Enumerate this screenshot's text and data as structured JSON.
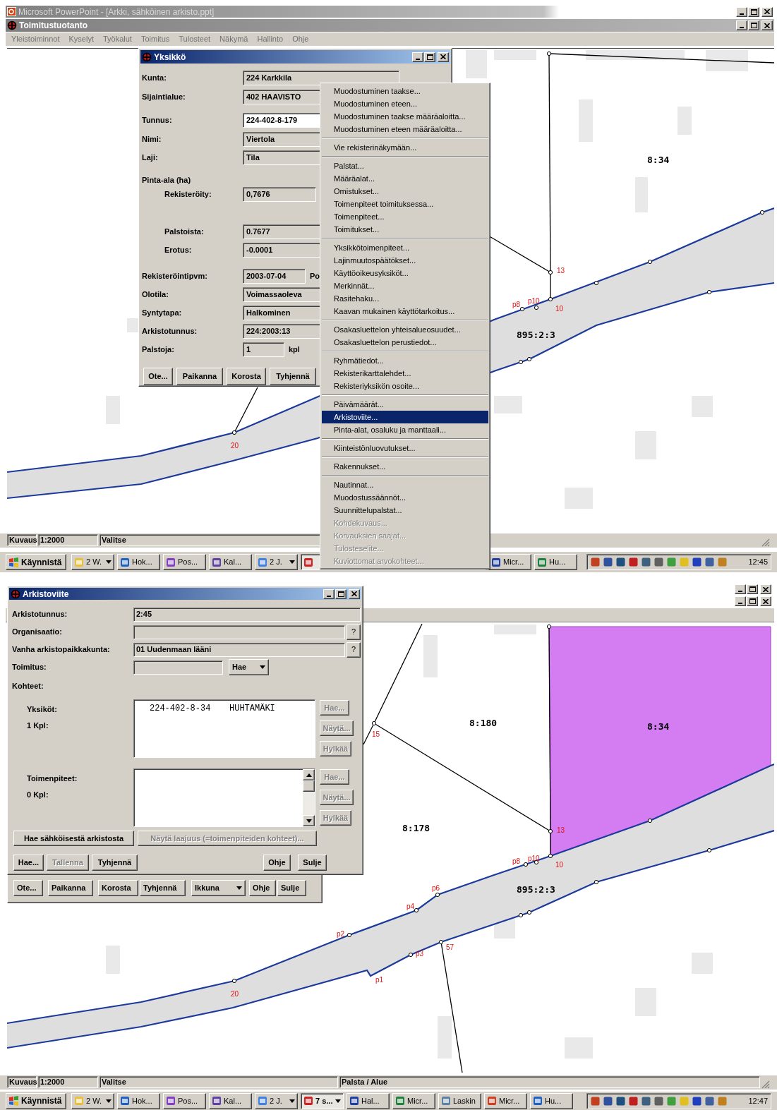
{
  "top": {
    "ppt_title": "Microsoft PowerPoint - [Arkki, sähköinen arkisto.ppt]",
    "app_title": "Toimitustuotanto",
    "menu": [
      "Yleistoiminnot",
      "Kyselyt",
      "Työkalut",
      "Toimitus",
      "Tulosteet",
      "Näkymä",
      "Hallinto",
      "Ohje"
    ],
    "map": {
      "labels": [
        "8:34",
        "13",
        "p8",
        "p10",
        "10",
        "895:2:3",
        "20"
      ]
    },
    "unit_dialog": {
      "title": "Yksikkö",
      "fields": [
        {
          "label": "Kunta:",
          "value": "224 Karkkila",
          "editable": false
        },
        {
          "label": "Sijaintialue:",
          "value": "402 HAAVISTO",
          "editable": false
        },
        {
          "label": "Tunnus:",
          "value": "224-402-8-179",
          "editable": true
        },
        {
          "label": "Nimi:",
          "value": "Viertola",
          "editable": false
        },
        {
          "label": "Laji:",
          "value": "Tila",
          "editable": false
        },
        {
          "label": "Pinta-ala (ha)",
          "children": [
            {
              "label": "Rekisteröity:",
              "value": "0,7676",
              "editable": false
            },
            {
              "label": "Palstoista:",
              "value": "0.7677",
              "editable": false
            },
            {
              "label": "Erotus:",
              "value": "-0.0001",
              "editable": false
            }
          ]
        },
        {
          "label": "Rekisteröintipvm:",
          "value": "2003-07-04",
          "editable": false,
          "suffix": "Po"
        },
        {
          "label": "Olotila:",
          "value": "Voimassaoleva",
          "editable": false
        },
        {
          "label": "Syntytapa:",
          "value": "Halkominen",
          "editable": false
        },
        {
          "label": "Arkistotunnus:",
          "value": "224:2003:13",
          "editable": false
        },
        {
          "label": "Palstoja:",
          "value": "1",
          "editable": false,
          "suffix": "kpl"
        }
      ],
      "buttons": [
        "Ote...",
        "Paikanna",
        "Korosta",
        "Tyhjennä"
      ]
    },
    "context_menu": {
      "groups": [
        {
          "items": [
            {
              "label": "Muodostuminen taakse...",
              "selected": false,
              "disabled": false
            },
            {
              "label": "Muodostuminen eteen...",
              "selected": false,
              "disabled": false
            },
            {
              "label": "Muodostuminen taakse määräaloitta...",
              "selected": false,
              "disabled": false
            },
            {
              "label": "Muodostuminen eteen määräaloitta...",
              "selected": false,
              "disabled": false
            }
          ]
        },
        {
          "items": [
            {
              "label": "Vie rekisterinäkymään...",
              "selected": false,
              "disabled": false
            }
          ]
        },
        {
          "items": [
            {
              "label": "Palstat...",
              "selected": false,
              "disabled": false
            },
            {
              "label": "Määräalat...",
              "selected": false,
              "disabled": false
            },
            {
              "label": "Omistukset...",
              "selected": false,
              "disabled": false
            },
            {
              "label": "Toimenpiteet toimituksessa...",
              "selected": false,
              "disabled": false
            },
            {
              "label": "Toimenpiteet...",
              "selected": false,
              "disabled": false
            },
            {
              "label": "Toimitukset...",
              "selected": false,
              "disabled": false
            }
          ]
        },
        {
          "items": [
            {
              "label": "Yksikkötoimenpiteet...",
              "selected": false,
              "disabled": false
            },
            {
              "label": "Lajinmuutospäätökset...",
              "selected": false,
              "disabled": false
            },
            {
              "label": "Käyttöoikeusyksiköt...",
              "selected": false,
              "disabled": false
            },
            {
              "label": "Merkinnät...",
              "selected": false,
              "disabled": false
            },
            {
              "label": "Rasitehaku...",
              "selected": false,
              "disabled": false
            },
            {
              "label": "Kaavan mukainen käyttötarkoitus...",
              "selected": false,
              "disabled": false
            }
          ]
        },
        {
          "items": [
            {
              "label": "Osakasluettelon yhteisalueosuudet...",
              "selected": false,
              "disabled": false
            },
            {
              "label": "Osakasluettelon perustiedot...",
              "selected": false,
              "disabled": false
            }
          ]
        },
        {
          "items": [
            {
              "label": "Ryhmätiedot...",
              "selected": false,
              "disabled": false
            },
            {
              "label": "Rekisterikarttalehdet...",
              "selected": false,
              "disabled": false
            },
            {
              "label": "Rekisteriyksikön osoite...",
              "selected": false,
              "disabled": false
            }
          ]
        },
        {
          "items": [
            {
              "label": "Päivämäärät...",
              "selected": false,
              "disabled": false
            },
            {
              "label": "Arkistoviite...",
              "selected": true,
              "disabled": false
            },
            {
              "label": "Pinta-alat, osaluku ja manttaali...",
              "selected": false,
              "disabled": false
            }
          ]
        },
        {
          "items": [
            {
              "label": "Kiinteistönluovutukset...",
              "selected": false,
              "disabled": false
            }
          ]
        },
        {
          "items": [
            {
              "label": "Rakennukset...",
              "selected": false,
              "disabled": false
            }
          ]
        },
        {
          "items": [
            {
              "label": "Nautinnat...",
              "selected": false,
              "disabled": false
            },
            {
              "label": "Muodostussäännöt...",
              "selected": false,
              "disabled": false
            },
            {
              "label": "Suunnittelupalstat...",
              "selected": false,
              "disabled": false
            },
            {
              "label": "Kohdekuvaus...",
              "selected": false,
              "disabled": true
            },
            {
              "label": "Korvauksien saajat...",
              "selected": false,
              "disabled": true
            },
            {
              "label": "Tulosteselite...",
              "selected": false,
              "disabled": true
            },
            {
              "label": "Kuviottomat arvokohteet...",
              "selected": false,
              "disabled": true
            }
          ]
        }
      ]
    },
    "status_bar": [
      "Kuvaus",
      "1:2000",
      "Valitse"
    ],
    "taskbar": {
      "start": "Käynnistä",
      "clock": "12:45",
      "tasks": [
        {
          "label": "2 W.",
          "dropdown": true,
          "pressed": false
        },
        {
          "label": "Hok...",
          "dropdown": false,
          "pressed": false
        },
        {
          "label": "Pos...",
          "dropdown": false,
          "pressed": false
        },
        {
          "label": "Kal...",
          "dropdown": false,
          "pressed": false
        },
        {
          "label": "2 J.",
          "dropdown": true,
          "pressed": false
        },
        {
          "dropdown": false,
          "pressed": true
        },
        {
          "label": "Micr...",
          "dropdown": false,
          "pressed": false
        },
        {
          "label": "Hu...",
          "dropdown": false,
          "pressed": false
        }
      ]
    }
  },
  "bottom": {
    "map": {
      "labels": [
        "8:180",
        "8:34",
        "8:178",
        "15",
        "13",
        "p8",
        "p10",
        "10",
        "895:2:3",
        "p6",
        "p4",
        "p2",
        "p3",
        "p1",
        "57",
        "20"
      ]
    },
    "archive_dialog": {
      "title": "Arkistoviite",
      "fields": [
        {
          "label": "Arkistotunnus:",
          "value": "2:45"
        },
        {
          "label": "Organisaatio:",
          "button": "?"
        },
        {
          "label": "Vanha arkistopaikkakunta:",
          "value": "01 Uudenmaan lääni",
          "button": "?"
        }
      ],
      "delivery": {
        "label": "Toimitus:",
        "dropdown": "Hae"
      },
      "targets_heading": "Kohteet:",
      "lists": [
        {
          "label": "Yksiköt:",
          "count": "1 Kpl:",
          "rows": [
            {
              "cells": [
                "224-402-8-34",
                "HUHTAMÄKI"
              ]
            }
          ],
          "buttons": [
            {
              "label": "Hae...",
              "disabled": true
            },
            {
              "label": "Näytä...",
              "disabled": true
            },
            {
              "label": "Hylkää",
              "disabled": true
            }
          ]
        },
        {
          "label": "Toimenpiteet:",
          "count": "0 Kpl:",
          "buttons": [
            {
              "label": "Hae...",
              "disabled": true
            },
            {
              "label": "Näytä...",
              "disabled": true
            },
            {
              "label": "Hylkää",
              "disabled": true
            }
          ]
        }
      ],
      "wide_buttons": [
        {
          "label": "Hae sähköisestä arkistosta",
          "disabled": false
        },
        {
          "label": "Näytä laajuus (=toimenpiteiden kohteet)...",
          "disabled": true
        }
      ],
      "buttons_left": [
        {
          "label": "Hae...",
          "disabled": false
        },
        {
          "label": "Tallenna",
          "disabled": true
        },
        {
          "label": "Tyhjennä",
          "disabled": false
        }
      ],
      "buttons_right": [
        {
          "label": "Ohje",
          "disabled": false
        },
        {
          "label": "Sulje",
          "disabled": false
        }
      ]
    },
    "unit_dialog_buttons": [
      {
        "label": "Ote...",
        "dropdown": false
      },
      {
        "label": "Paikanna",
        "dropdown": false
      },
      {
        "label": "Korosta",
        "dropdown": false
      },
      {
        "label": "Tyhjennä",
        "dropdown": false
      },
      {
        "label": "Ikkuna",
        "dropdown": true
      },
      {
        "label": "Ohje",
        "dropdown": false
      },
      {
        "label": "Sulje",
        "dropdown": false
      }
    ],
    "status_bar": [
      "Kuvaus",
      "1:2000",
      "Valitse",
      "Palsta / Alue"
    ],
    "taskbar": {
      "start": "Käynnistä",
      "clock": "12:47",
      "tasks": [
        {
          "label": "2 W.",
          "dropdown": true,
          "pressed": false
        },
        {
          "label": "Hok...",
          "dropdown": false,
          "pressed": false
        },
        {
          "label": "Pos...",
          "dropdown": false,
          "pressed": false
        },
        {
          "label": "Kal...",
          "dropdown": false,
          "pressed": false
        },
        {
          "label": "2 J.",
          "dropdown": true,
          "pressed": false
        },
        {
          "label": "7 s...",
          "dropdown": true,
          "pressed": true
        },
        {
          "label": "Hal...",
          "dropdown": false,
          "pressed": false
        },
        {
          "label": "Micr...",
          "dropdown": false,
          "pressed": false
        },
        {
          "label": "Laskin",
          "dropdown": false,
          "pressed": false
        },
        {
          "label": "Micr...",
          "dropdown": false,
          "pressed": false
        },
        {
          "label": "Hu...",
          "dropdown": false,
          "pressed": false
        }
      ]
    }
  }
}
